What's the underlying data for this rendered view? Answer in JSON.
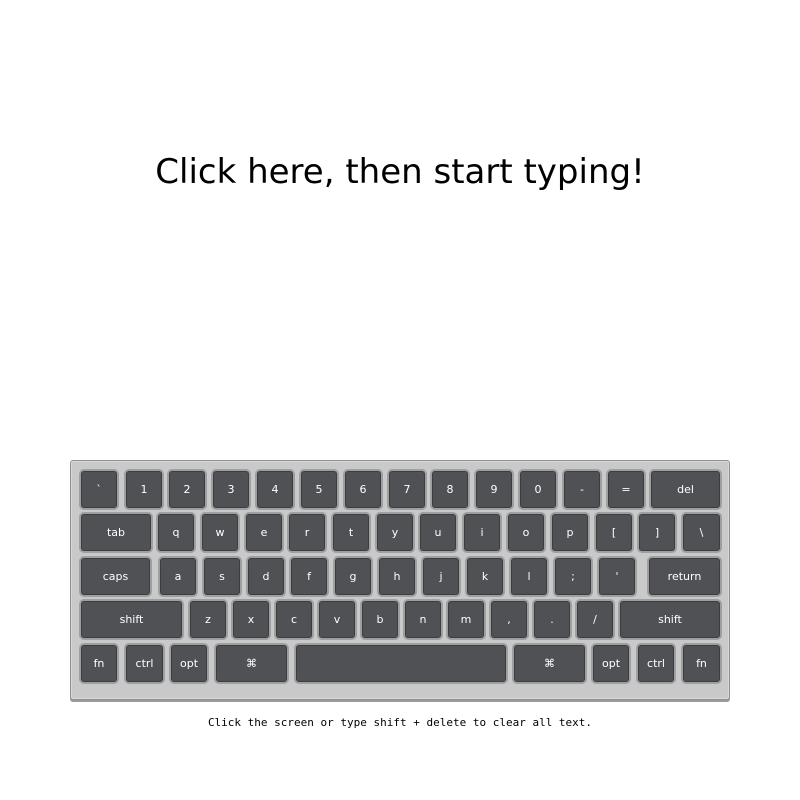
{
  "prompt": {
    "text": "Click here, then start typing!"
  },
  "keyboard": {
    "colors": {
      "frame": "#c9c9c9",
      "key": "#4f5154",
      "key_text": "#ffffff"
    },
    "rows": [
      [
        "`",
        "1",
        "2",
        "3",
        "4",
        "5",
        "6",
        "7",
        "8",
        "9",
        "0",
        "-",
        "=",
        "del"
      ],
      [
        "tab",
        "q",
        "w",
        "e",
        "r",
        "t",
        "y",
        "u",
        "i",
        "o",
        "p",
        "[",
        "]",
        "\\"
      ],
      [
        "caps",
        "a",
        "s",
        "d",
        "f",
        "g",
        "h",
        "j",
        "k",
        "l",
        ";",
        "'",
        "return"
      ],
      [
        "shift",
        "z",
        "x",
        "c",
        "v",
        "b",
        "n",
        "m",
        ",",
        ".",
        "/",
        "shift"
      ],
      [
        "fn",
        "ctrl",
        "opt",
        "⌘",
        "",
        "⌘",
        "opt",
        "ctrl",
        "fn"
      ]
    ]
  },
  "footer": {
    "text": "Click the screen or type shift + delete to clear all text."
  }
}
